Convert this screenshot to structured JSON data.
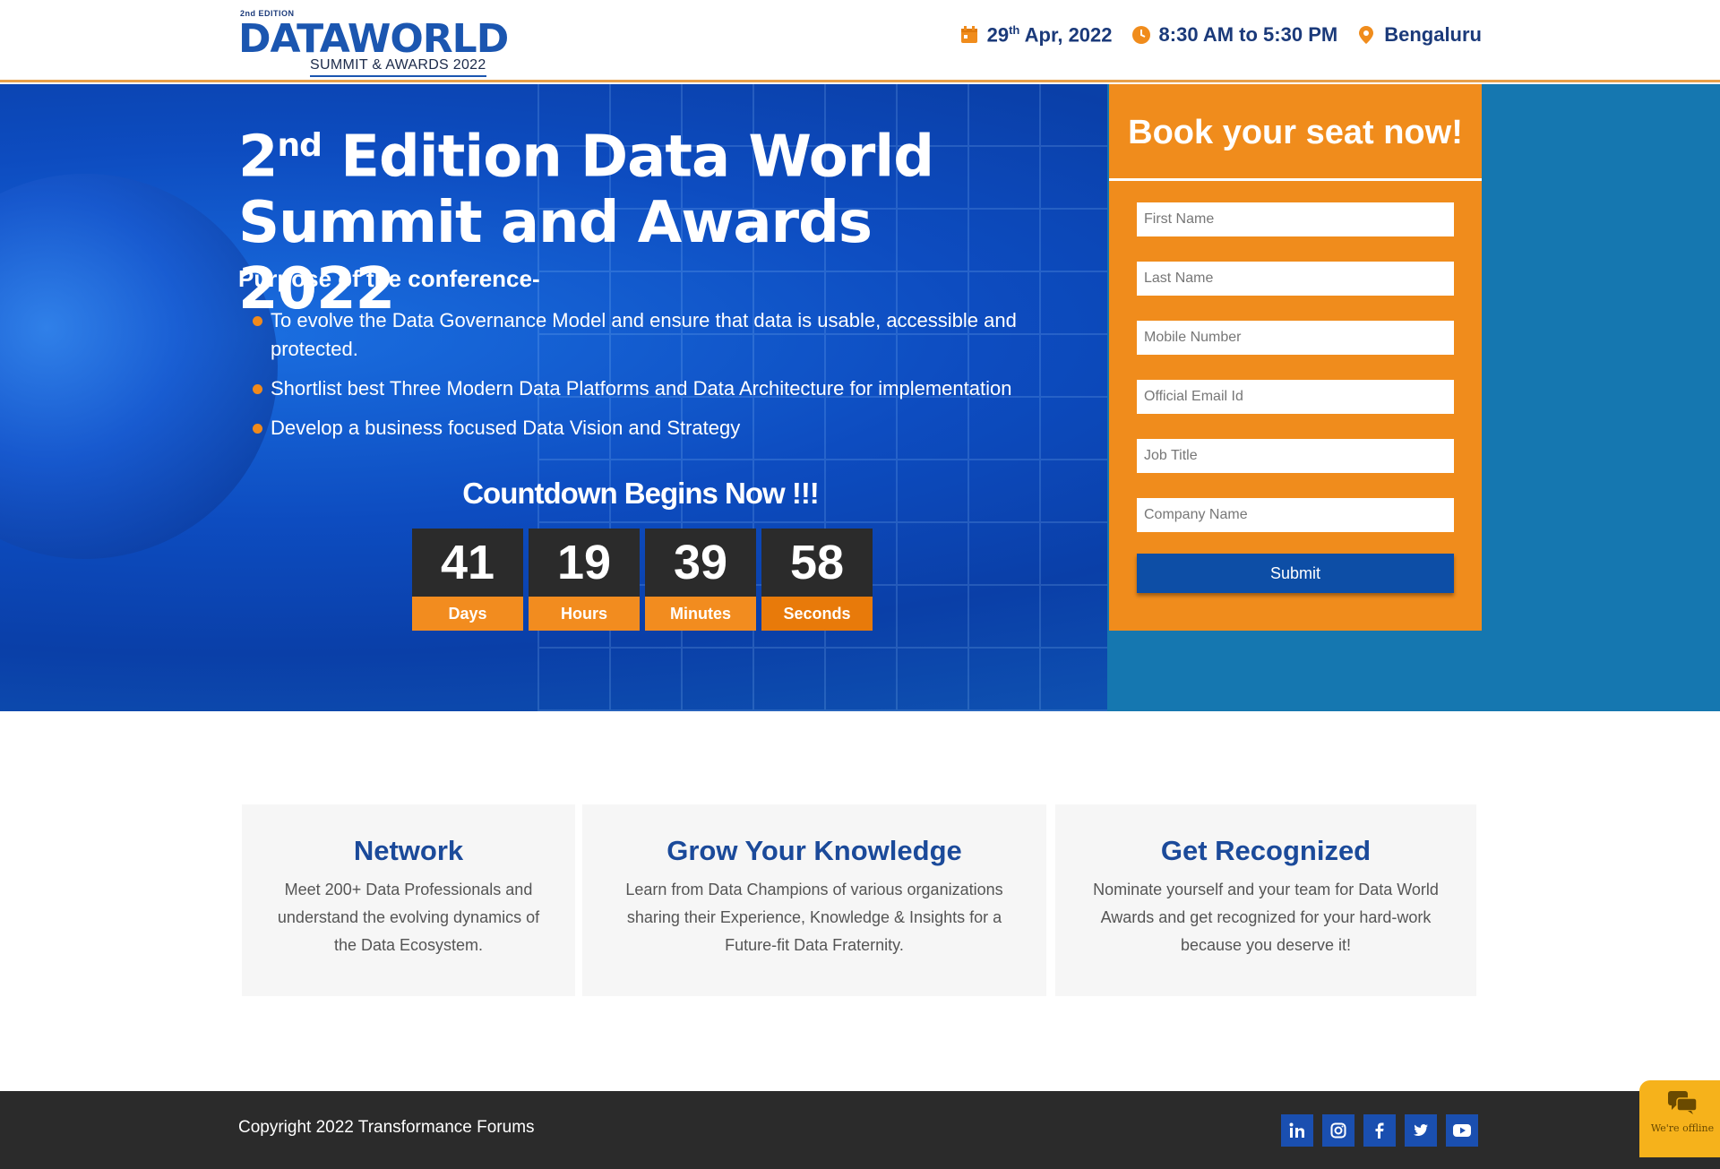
{
  "header": {
    "logo": {
      "edition": "2nd EDITION",
      "brand": "DATAWORLD",
      "subtitle": "SUMMIT & AWARDS 2022"
    },
    "date": {
      "day": "29",
      "suffix": "th",
      "rest": " Apr, 2022"
    },
    "time": "8:30 AM to 5:30 PM",
    "location": "Bengaluru",
    "icons": [
      "calendar-icon",
      "clock-icon",
      "location-pin-icon"
    ],
    "accent_color": "#f08c1c"
  },
  "hero": {
    "title_num": "2",
    "title_sup": "nd",
    "title_rest": " Edition Data World Summit and Awards 2022",
    "purpose_heading": "Purpose of the conference-",
    "bullets": [
      "To evolve the Data Governance Model and ensure that data is usable, accessible and protected.",
      "Shortlist best Three Modern Data Platforms and Data Architecture for implementation",
      "Develop a business focused Data Vision and Strategy"
    ],
    "countdown_title": "Countdown Begins Now !!!",
    "countdown": [
      {
        "value": "41",
        "label": "Days"
      },
      {
        "value": "19",
        "label": "Hours"
      },
      {
        "value": "39",
        "label": "Minutes"
      },
      {
        "value": "58",
        "label": "Seconds"
      }
    ]
  },
  "form": {
    "heading": "Book your seat now!",
    "fields": {
      "first_name": "First Name",
      "last_name": "Last Name",
      "mobile": "Mobile Number",
      "email": "Official Email Id",
      "job_title": "Job Title",
      "company": "Company Name"
    },
    "submit_label": "Submit",
    "button_color": "#0d4ea6"
  },
  "features": [
    {
      "title": "Network",
      "text": "Meet 200+ Data Professionals and understand the evolving dynamics of the Data Ecosystem."
    },
    {
      "title": "Grow Your Knowledge",
      "text": "Learn from Data Champions of various organizations sharing their Experience, Knowledge & Insights for a Future-fit Data Fraternity."
    },
    {
      "title": "Get Recognized",
      "text": "Nominate yourself and your team for Data World Awards and get recognized for your hard-work because you deserve it!"
    }
  ],
  "footer": {
    "copyright": "Copyright 2022 Transformance Forums",
    "socials": [
      "linkedin-icon",
      "instagram-icon",
      "facebook-icon",
      "twitter-icon",
      "youtube-icon"
    ],
    "chat_status": "We're offline"
  }
}
